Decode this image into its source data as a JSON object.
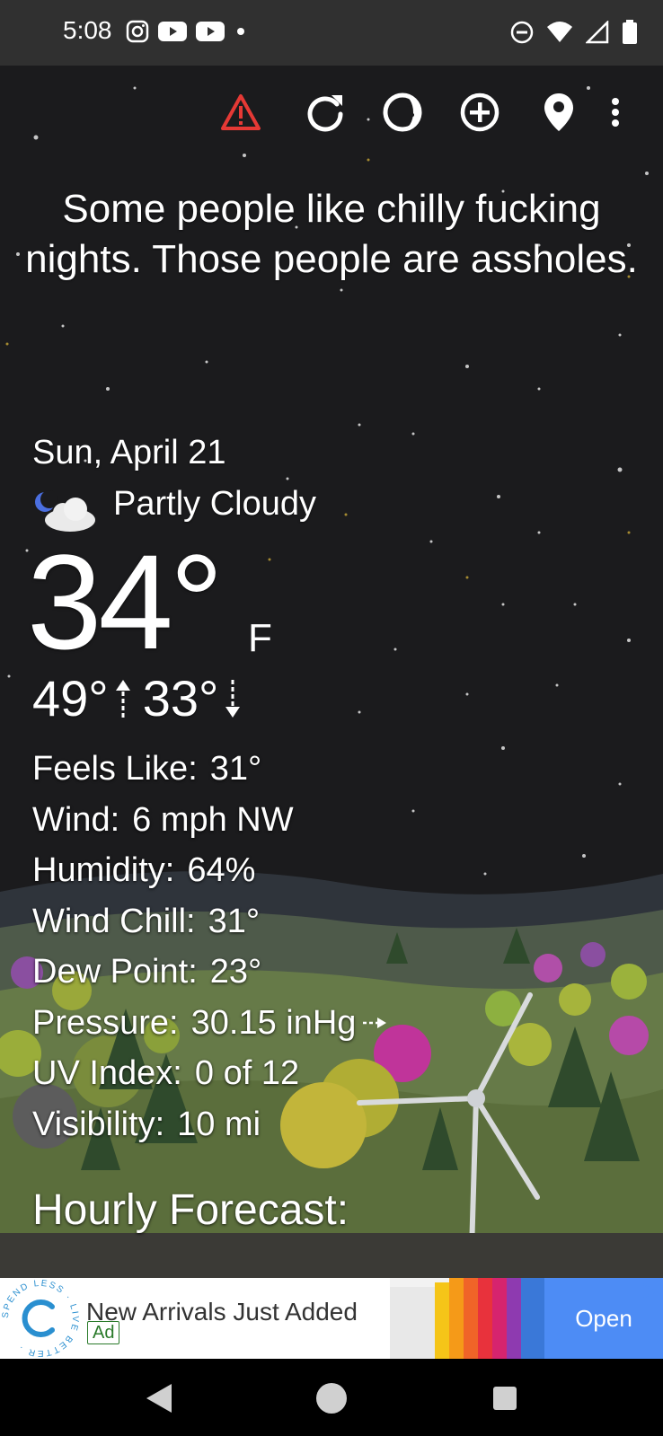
{
  "status_bar": {
    "time": "5:08",
    "left_icons": [
      "instagram-icon",
      "youtube-icon",
      "youtube-icon",
      "dot-icon"
    ],
    "right_icons": [
      "do-not-disturb-icon",
      "wifi-icon",
      "cell-signal-icon",
      "battery-icon"
    ]
  },
  "toolbar": {
    "icons": [
      "warning-icon",
      "refresh-icon",
      "moon-phase-icon",
      "add-location-icon",
      "location-pin-icon",
      "more-vert-icon"
    ],
    "warning_color": "#e53935"
  },
  "quote": "Some people like chilly fucking nights. Those people are assholes.",
  "current": {
    "date": "Sun, April 21",
    "condition": "Partly Cloudy",
    "condition_icon": "partly-cloudy-night-icon",
    "temperature": "34°",
    "unit": "F",
    "high": "49°",
    "low": "33°"
  },
  "details": [
    {
      "label": "Feels Like:",
      "value": "31°"
    },
    {
      "label": "Wind:",
      "value": "6 mph NW"
    },
    {
      "label": "Humidity:",
      "value": "64%"
    },
    {
      "label": "Wind Chill:",
      "value": "31°"
    },
    {
      "label": "Dew Point:",
      "value": "23°"
    },
    {
      "label": "Pressure:",
      "value": "30.15 inHg"
    },
    {
      "label": "UV Index:",
      "value": "0 of 12"
    },
    {
      "label": "Visibility:",
      "value": "10 mi"
    }
  ],
  "hourly_heading": "Hourly Forecast:",
  "ad": {
    "logo_text": "SPEND LESS · LIVE BETTER",
    "title": "New Arrivals Just Added",
    "badge": "Ad",
    "button": "Open",
    "button_color": "#4d8cf5"
  },
  "nav": [
    "back-icon",
    "home-icon",
    "recents-icon"
  ]
}
